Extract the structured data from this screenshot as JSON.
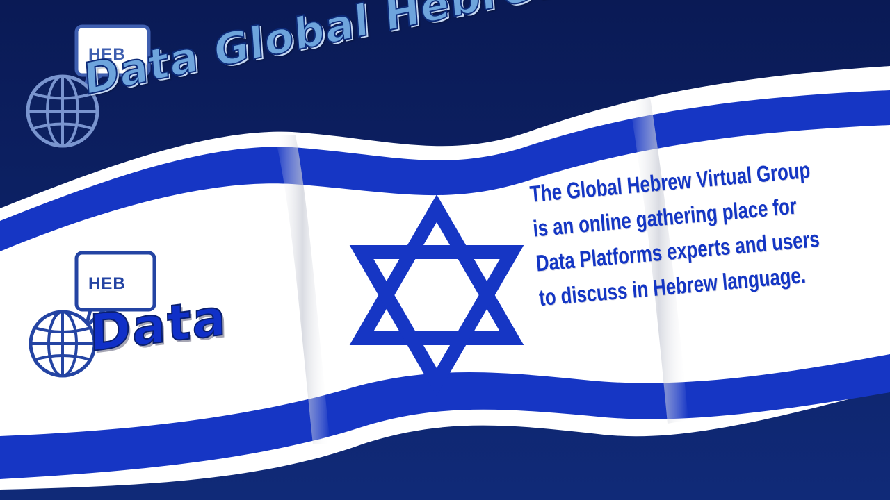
{
  "title": "Data Global Hebrew",
  "logo_top": {
    "badge_text": "HEB",
    "icon": "globe-speech-bubble-icon"
  },
  "logo_main": {
    "badge_text": "HEB",
    "word": "Data",
    "icon": "globe-speech-bubble-icon"
  },
  "description": {
    "lines": [
      "The Global Hebrew Virtual Group",
      "is an online gathering place for",
      "Data Platforms experts and users",
      "to discuss in Hebrew language."
    ]
  },
  "flag": {
    "emblem": "star-of-david-icon"
  },
  "colors": {
    "background": "#0b1d5c",
    "flag_blue": "#1636c4",
    "flag_white": "#ffffff",
    "title_fill": "#6ea4dc"
  }
}
